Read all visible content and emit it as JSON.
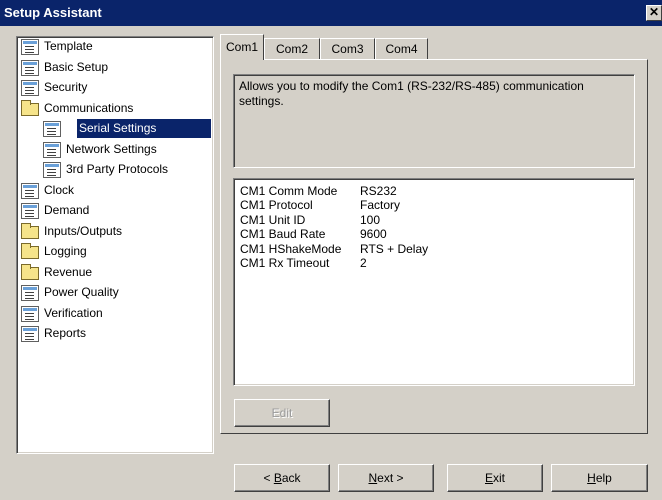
{
  "window": {
    "title": "Setup Assistant"
  },
  "tree": {
    "items": [
      {
        "label": "Template",
        "icon": "doc-icon",
        "level": 0
      },
      {
        "label": "Basic Setup",
        "icon": "doc-icon",
        "level": 0
      },
      {
        "label": "Security",
        "icon": "doc-icon",
        "level": 0
      },
      {
        "label": "Communications",
        "icon": "folder-icon",
        "level": 0
      },
      {
        "label": "Serial Settings",
        "icon": "doc-icon",
        "level": 1,
        "selected": true
      },
      {
        "label": "Network Settings",
        "icon": "doc-icon",
        "level": 1
      },
      {
        "label": "3rd Party Protocols",
        "icon": "doc-icon",
        "level": 1
      },
      {
        "label": "Clock",
        "icon": "doc-icon",
        "level": 0
      },
      {
        "label": "Demand",
        "icon": "doc-icon",
        "level": 0
      },
      {
        "label": "Inputs/Outputs",
        "icon": "folder-icon",
        "level": 0
      },
      {
        "label": "Logging",
        "icon": "folder-icon",
        "level": 0
      },
      {
        "label": "Revenue",
        "icon": "folder-icon",
        "level": 0
      },
      {
        "label": "Power Quality",
        "icon": "doc-icon",
        "level": 0
      },
      {
        "label": "Verification",
        "icon": "doc-icon",
        "level": 0
      },
      {
        "label": "Reports",
        "icon": "doc-icon",
        "level": 0
      }
    ]
  },
  "tabs": [
    {
      "label": "Com1",
      "active": true
    },
    {
      "label": "Com2"
    },
    {
      "label": "Com3"
    },
    {
      "label": "Com4"
    }
  ],
  "description": "Allows you to modify the Com1 (RS-232/RS-485) communication settings.",
  "settings": [
    {
      "name": "CM1 Comm Mode",
      "value": "RS232"
    },
    {
      "name": "CM1 Protocol",
      "value": "Factory"
    },
    {
      "name": "CM1 Unit ID",
      "value": "100"
    },
    {
      "name": "CM1 Baud Rate",
      "value": "9600"
    },
    {
      "name": "CM1 HShakeMode",
      "value": "RTS + Delay"
    },
    {
      "name": "CM1 Rx Timeout",
      "value": "2"
    }
  ],
  "buttons": {
    "edit": "Edit",
    "back": {
      "pre": "< ",
      "hot": "B",
      "post": "ack"
    },
    "next": {
      "pre": "",
      "hot": "N",
      "post": "ext >"
    },
    "exit": {
      "pre": "",
      "hot": "E",
      "post": "xit"
    },
    "help": {
      "pre": "",
      "hot": "H",
      "post": "elp"
    },
    "close": "✕"
  },
  "colors": {
    "titlebar": "#0a246a",
    "selection": "#0a246a",
    "face": "#d4d0c8"
  }
}
